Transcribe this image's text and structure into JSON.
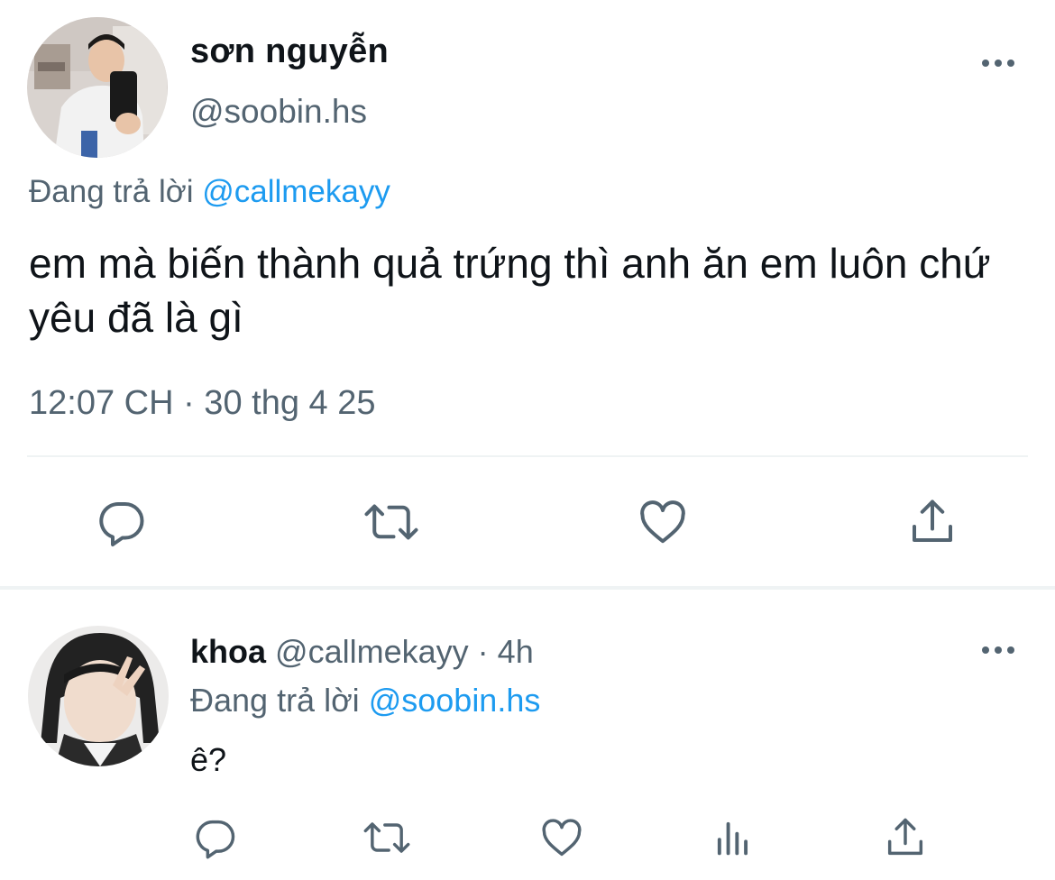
{
  "main_tweet": {
    "author_name": "sơn nguyễn",
    "author_handle": "@soobin.hs",
    "reply_prefix": "Đang trả lời",
    "reply_to": "@callmekayy",
    "text": "em mà biến thành quả trứng thì anh ăn em luôn chứ yêu đã là gì",
    "timestamp": "12:07 CH · 30 thg 4 25",
    "icons": [
      "reply-icon",
      "retweet-icon",
      "like-icon",
      "share-icon",
      "more-icon"
    ]
  },
  "reply_tweet": {
    "author_name": "khoa",
    "author_handle": "@callmekayy",
    "separator": "·",
    "time": "4h",
    "reply_prefix": "Đang trả lời",
    "reply_to": "@soobin.hs",
    "text": "ê?",
    "icons": [
      "reply-icon",
      "retweet-icon",
      "like-icon",
      "views-icon",
      "share-icon",
      "more-icon"
    ]
  },
  "colors": {
    "text_primary": "#0f1419",
    "text_secondary": "#536471",
    "accent": "#1d9bf0",
    "divider": "#eff3f4"
  }
}
